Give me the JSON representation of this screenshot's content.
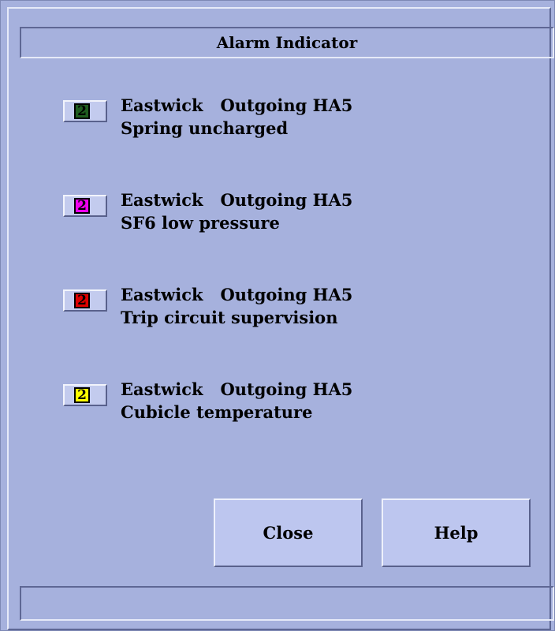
{
  "window": {
    "title": "Alarm Indicator"
  },
  "alarms": [
    {
      "count": "2",
      "location": "Eastwick   Outgoing HA5",
      "description": "Spring uncharged",
      "color": "#1f5c1f",
      "text_color": "#000000"
    },
    {
      "count": "2",
      "location": "Eastwick   Outgoing HA5",
      "description": "SF6 low pressure",
      "color": "#ee00ee",
      "text_color": "#000000"
    },
    {
      "count": "2",
      "location": "Eastwick   Outgoing HA5",
      "description": "Trip circuit supervision",
      "color": "#dd0000",
      "text_color": "#000000"
    },
    {
      "count": "2",
      "location": "Eastwick   Outgoing HA5",
      "description": "Cubicle temperature",
      "color": "#ffff00",
      "text_color": "#000000"
    }
  ],
  "buttons": {
    "close_label": "Close",
    "help_label": "Help"
  },
  "status": {
    "text": ""
  }
}
